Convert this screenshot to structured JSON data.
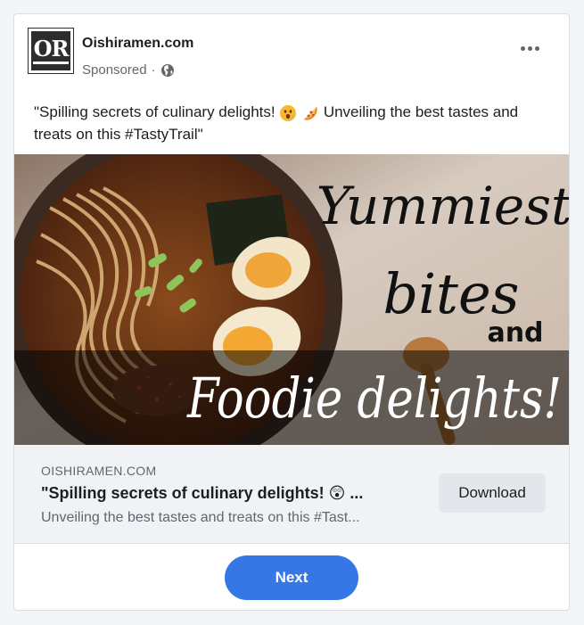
{
  "post": {
    "page_name": "Oishiramen.com",
    "logo_text": "OR",
    "sponsored_label": "Sponsored",
    "separator": "·",
    "caption_part1": "\"Spilling secrets of culinary delights! ",
    "caption_part2": " Unveiling the best tastes and treats on this #TastyTrail\""
  },
  "hero": {
    "line1": "Yummiest",
    "line2": "bites",
    "line3": "and",
    "line4": "Foodie delights!"
  },
  "link": {
    "domain": "OISHIRAMEN.COM",
    "title": "\"Spilling secrets of culinary delights! 😲 ...",
    "description": "Unveiling the best tastes and treats on this #Tast...",
    "cta_label": "Download"
  },
  "footer": {
    "next_label": "Next"
  },
  "colors": {
    "accent": "#3578e5",
    "link_bg": "#f0f2f5",
    "cta_bg": "#e4e6eb"
  },
  "icons": [
    "globe-icon",
    "more-options-icon",
    "drooling-face-emoji",
    "pizza-emoji"
  ]
}
